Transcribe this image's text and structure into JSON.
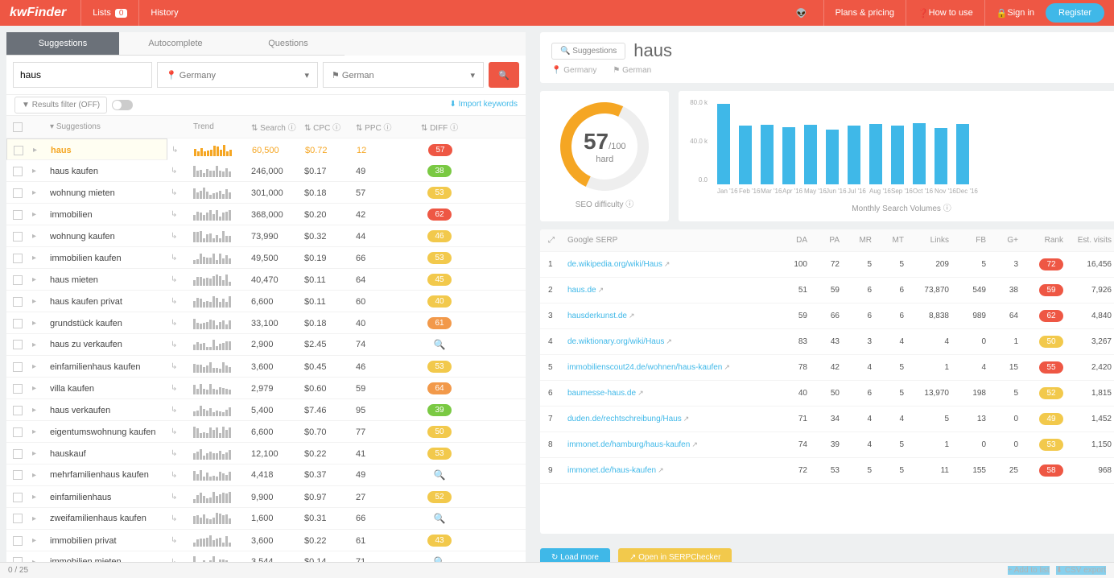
{
  "header": {
    "logo": "kwFinder",
    "lists": "Lists",
    "lists_count": "0",
    "history": "History",
    "plans": "Plans & pricing",
    "howto": "How to use",
    "signin": "Sign in",
    "register": "Register"
  },
  "tabs": [
    "Suggestions",
    "Autocomplete",
    "Questions"
  ],
  "search": {
    "value": "haus",
    "location": "Germany",
    "language": "German"
  },
  "filter": {
    "label": "Results filter (OFF)",
    "import": "Import keywords"
  },
  "cols": {
    "sug": "Suggestions",
    "trend": "Trend",
    "search": "Search",
    "cpc": "CPC",
    "ppc": "PPC",
    "diff": "DIFF"
  },
  "rows": [
    {
      "kw": "haus",
      "search": "60,500",
      "cpc": "$0.72",
      "ppc": "12",
      "diff": "57",
      "c": "p-orange",
      "active": true
    },
    {
      "kw": "haus kaufen",
      "search": "246,000",
      "cpc": "$0.17",
      "ppc": "49",
      "diff": "38",
      "c": "p-green"
    },
    {
      "kw": "wohnung mieten",
      "search": "301,000",
      "cpc": "$0.18",
      "ppc": "57",
      "diff": "53",
      "c": "p-yellow"
    },
    {
      "kw": "immobilien",
      "search": "368,000",
      "cpc": "$0.20",
      "ppc": "42",
      "diff": "62",
      "c": "p-orange"
    },
    {
      "kw": "wohnung kaufen",
      "search": "73,990",
      "cpc": "$0.32",
      "ppc": "44",
      "diff": "46",
      "c": "p-yellow"
    },
    {
      "kw": "immobilien kaufen",
      "search": "49,500",
      "cpc": "$0.19",
      "ppc": "66",
      "diff": "53",
      "c": "p-yellow"
    },
    {
      "kw": "haus mieten",
      "search": "40,470",
      "cpc": "$0.11",
      "ppc": "64",
      "diff": "45",
      "c": "p-yellow"
    },
    {
      "kw": "haus kaufen privat",
      "search": "6,600",
      "cpc": "$0.11",
      "ppc": "60",
      "diff": "40",
      "c": "p-yellow"
    },
    {
      "kw": "grundstück kaufen",
      "search": "33,100",
      "cpc": "$0.18",
      "ppc": "40",
      "diff": "61",
      "c": "p-amber"
    },
    {
      "kw": "haus zu verkaufen",
      "search": "2,900",
      "cpc": "$2.45",
      "ppc": "74",
      "diff": "",
      "c": ""
    },
    {
      "kw": "einfamilienhaus kaufen",
      "search": "3,600",
      "cpc": "$0.45",
      "ppc": "46",
      "diff": "53",
      "c": "p-yellow"
    },
    {
      "kw": "villa kaufen",
      "search": "2,979",
      "cpc": "$0.60",
      "ppc": "59",
      "diff": "64",
      "c": "p-amber"
    },
    {
      "kw": "haus verkaufen",
      "search": "5,400",
      "cpc": "$7.46",
      "ppc": "95",
      "diff": "39",
      "c": "p-green"
    },
    {
      "kw": "eigentumswohnung kaufen",
      "search": "6,600",
      "cpc": "$0.70",
      "ppc": "77",
      "diff": "50",
      "c": "p-yellow"
    },
    {
      "kw": "hauskauf",
      "search": "12,100",
      "cpc": "$0.22",
      "ppc": "41",
      "diff": "53",
      "c": "p-yellow"
    },
    {
      "kw": "mehrfamilienhaus kaufen",
      "search": "4,418",
      "cpc": "$0.37",
      "ppc": "49",
      "diff": "",
      "c": ""
    },
    {
      "kw": "einfamilienhaus",
      "search": "9,900",
      "cpc": "$0.97",
      "ppc": "27",
      "diff": "52",
      "c": "p-yellow"
    },
    {
      "kw": "zweifamilienhaus kaufen",
      "search": "1,600",
      "cpc": "$0.31",
      "ppc": "66",
      "diff": "",
      "c": ""
    },
    {
      "kw": "immobilien privat",
      "search": "3,600",
      "cpc": "$0.22",
      "ppc": "61",
      "diff": "43",
      "c": "p-yellow"
    },
    {
      "kw": "immobilien mieten",
      "search": "3,544",
      "cpc": "$0.14",
      "ppc": "71",
      "diff": "",
      "c": ""
    }
  ],
  "right": {
    "sug": "Suggestions",
    "title": "haus",
    "loc": "Germany",
    "lang": "German",
    "score": "57",
    "denom": "/100",
    "hard": "hard",
    "seo": "SEO difficulty",
    "msv": "Monthly Search Volumes"
  },
  "chart_data": {
    "type": "bar",
    "categories": [
      "Jan '16",
      "Feb '16",
      "Mar '16",
      "Apr '16",
      "May '16",
      "Jun '16",
      "Jul '16",
      "Aug '16",
      "Sep '16",
      "Oct '16",
      "Nov '16",
      "Dec '16"
    ],
    "values": [
      88000,
      64000,
      65000,
      63000,
      65000,
      60000,
      64000,
      66000,
      64000,
      67000,
      62000,
      66000
    ],
    "ylabel": "",
    "ylim": [
      0,
      90000
    ],
    "yticks": [
      "80.0 k",
      "40.0 k",
      "0.0"
    ],
    "title": "Monthly Search Volumes"
  },
  "serp_cols": {
    "url": "Google SERP",
    "da": "DA",
    "pa": "PA",
    "mr": "MR",
    "mt": "MT",
    "links": "Links",
    "fb": "FB",
    "g": "G+",
    "rank": "Rank",
    "ev": "Est. visits"
  },
  "serp": [
    {
      "n": "1",
      "url": "de.wikipedia.org/wiki/Haus",
      "da": "100",
      "pa": "72",
      "mr": "5",
      "mt": "5",
      "links": "209",
      "fb": "5",
      "g": "3",
      "rank": "72",
      "rc": "p-orange",
      "ev": "16,456"
    },
    {
      "n": "2",
      "url": "haus.de",
      "da": "51",
      "pa": "59",
      "mr": "6",
      "mt": "6",
      "links": "73,870",
      "fb": "549",
      "g": "38",
      "rank": "59",
      "rc": "p-orange",
      "ev": "7,926"
    },
    {
      "n": "3",
      "url": "hausderkunst.de",
      "da": "59",
      "pa": "66",
      "mr": "6",
      "mt": "6",
      "links": "8,838",
      "fb": "989",
      "g": "64",
      "rank": "62",
      "rc": "p-orange",
      "ev": "4,840"
    },
    {
      "n": "4",
      "url": "de.wiktionary.org/wiki/Haus",
      "da": "83",
      "pa": "43",
      "mr": "3",
      "mt": "4",
      "links": "4",
      "fb": "0",
      "g": "1",
      "rank": "50",
      "rc": "p-yellow",
      "ev": "3,267"
    },
    {
      "n": "5",
      "url": "immobilienscout24.de/wohnen/haus-kaufen",
      "da": "78",
      "pa": "42",
      "mr": "4",
      "mt": "5",
      "links": "1",
      "fb": "4",
      "g": "15",
      "rank": "55",
      "rc": "p-orange",
      "ev": "2,420"
    },
    {
      "n": "6",
      "url": "baumesse-haus.de",
      "da": "40",
      "pa": "50",
      "mr": "6",
      "mt": "5",
      "links": "13,970",
      "fb": "198",
      "g": "5",
      "rank": "52",
      "rc": "p-yellow",
      "ev": "1,815"
    },
    {
      "n": "7",
      "url": "duden.de/rechtschreibung/Haus",
      "da": "71",
      "pa": "34",
      "mr": "4",
      "mt": "4",
      "links": "5",
      "fb": "13",
      "g": "0",
      "rank": "49",
      "rc": "p-yellow",
      "ev": "1,452"
    },
    {
      "n": "8",
      "url": "immonet.de/hamburg/haus-kaufen",
      "da": "74",
      "pa": "39",
      "mr": "4",
      "mt": "5",
      "links": "1",
      "fb": "0",
      "g": "0",
      "rank": "53",
      "rc": "p-yellow",
      "ev": "1,150"
    },
    {
      "n": "9",
      "url": "immonet.de/haus-kaufen",
      "da": "72",
      "pa": "53",
      "mr": "5",
      "mt": "5",
      "links": "11",
      "fb": "155",
      "g": "25",
      "rank": "58",
      "rc": "p-orange",
      "ev": "968"
    }
  ],
  "btns": {
    "load": "Load more",
    "open": "Open in SERPChecker"
  },
  "footer": {
    "count": "0 / 25",
    "add": "Add to list",
    "csv": "CSV export"
  }
}
